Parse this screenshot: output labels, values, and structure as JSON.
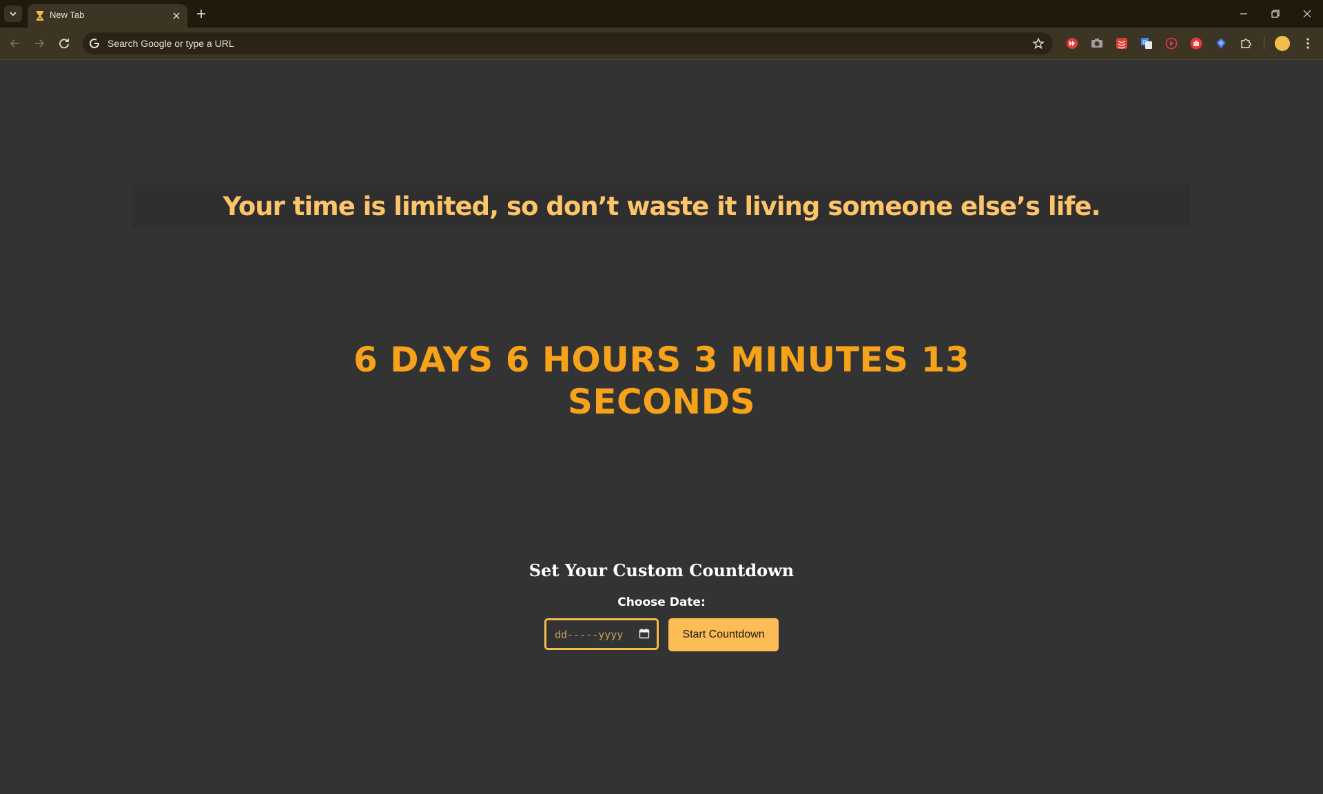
{
  "browser": {
    "tab": {
      "title": "New Tab"
    },
    "omnibox": {
      "placeholder": "Search Google or type a URL"
    },
    "accent_color": "#f2bd4b",
    "extensions": [
      "video-speed-icon",
      "camera-icon",
      "todoist-icon",
      "translate-icon",
      "screen-recorder-icon",
      "hand-stop-icon",
      "shield-icon",
      "puzzle-icon"
    ]
  },
  "page": {
    "quote": "Your time is limited, so don’t waste it living someone else’s life.",
    "countdown": {
      "line1": "6 DAYS 6 HOURS 3 MINUTES 13",
      "line2": "SECONDS"
    },
    "custom": {
      "title": "Set Your Custom Countdown",
      "date_label": "Choose Date:",
      "date_placeholder": "dd-----yyyy",
      "start_button": "Start Countdown"
    },
    "colors": {
      "background": "#333333",
      "quote": "#fdc46a",
      "countdown": "#f7a21b",
      "button": "#fcbc56"
    }
  }
}
